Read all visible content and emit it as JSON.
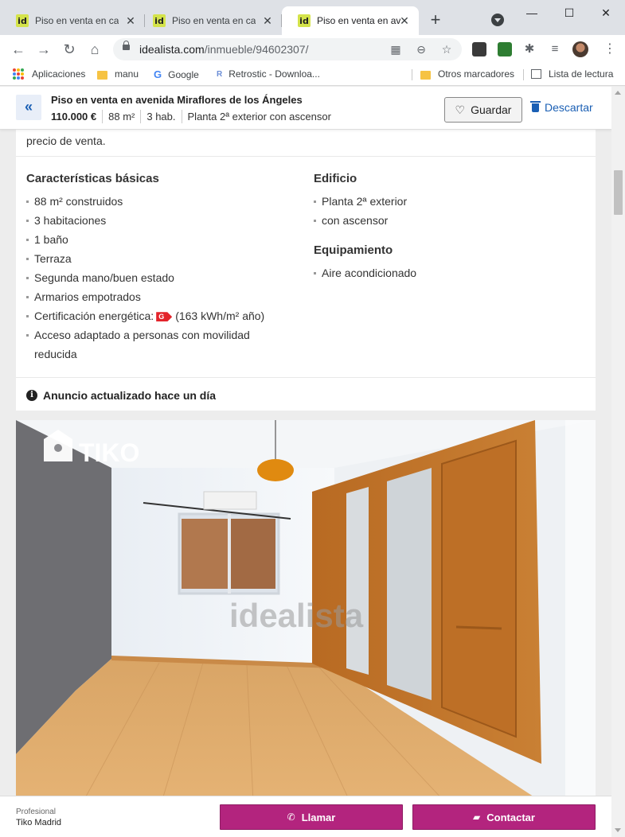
{
  "browser": {
    "tabs": [
      {
        "title": "Piso en venta en calle",
        "favicon": "id",
        "active": false
      },
      {
        "title": "Piso en venta en calle",
        "favicon": "id",
        "active": false
      },
      {
        "title": "Piso en venta en ave",
        "favicon": "id",
        "active": true
      }
    ],
    "url_host": "idealista.com",
    "url_path": "/inmueble/94602307/",
    "bookmarks": {
      "apps": "Aplicaciones",
      "manu": "manu",
      "google": "Google",
      "retrostic": "Retrostic - Downloa...",
      "other": "Otros marcadores",
      "reading_list": "Lista de lectura"
    }
  },
  "sticky_header": {
    "title": "Piso en venta en avenida Miraflores de los Ángeles",
    "price": "110.000 €",
    "size": "88 m²",
    "rooms": "3 hab.",
    "floor": "Planta 2ª exterior con ascensor",
    "save_label": "Guardar",
    "discard_label": "Descartar"
  },
  "intro_tail": "precio de venta.",
  "features": {
    "basic_title": "Características básicas",
    "basic_items": [
      "88 m² construidos",
      "3 habitaciones",
      "1 baño",
      "Terraza",
      "Segunda mano/buen estado",
      "Armarios empotrados"
    ],
    "energy_label": "Certificación energética:",
    "energy_rating": "G",
    "energy_value": "(163 kWh/m² año)",
    "accessibility_line1": "Acceso adaptado a personas con movilidad",
    "accessibility_line2": "reducida",
    "building_title": "Edificio",
    "building_items": [
      "Planta 2ª exterior",
      "con ascensor"
    ],
    "equipment_title": "Equipamiento",
    "equipment_items": [
      "Aire acondicionado"
    ]
  },
  "update_notice": "Anuncio actualizado hace un día",
  "photo": {
    "logo_text": "TIKO",
    "watermark": "idealista"
  },
  "contact": {
    "agent_type": "Profesional",
    "agent_name": "Tiko Madrid",
    "call_label": "Llamar",
    "contact_label": "Contactar"
  },
  "colors": {
    "brand_accent": "#b3247e",
    "link_blue": "#1a5fb4",
    "energy_g": "#e3242b"
  }
}
